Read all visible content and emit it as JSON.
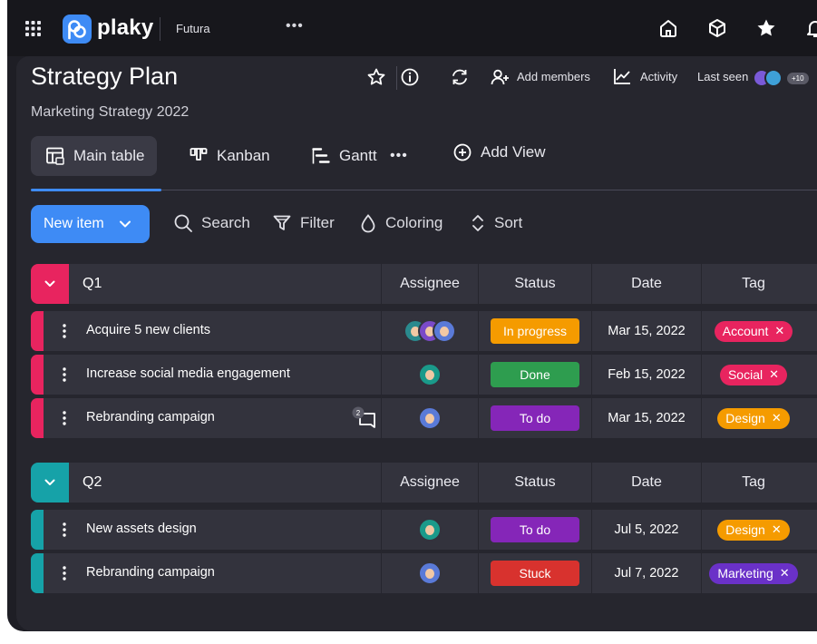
{
  "app": {
    "logo_text": "plaky",
    "workspace": "Futura",
    "more_label": "•••"
  },
  "board": {
    "title": "Strategy Plan",
    "subtitle": "Marketing Strategy 2022",
    "add_members_label": "Add members",
    "activity_label": "Activity",
    "last_seen_label": "Last seen",
    "last_seen_count": "+10"
  },
  "views": {
    "main_table": "Main table",
    "kanban": "Kanban",
    "gantt": "Gantt",
    "more": "•••",
    "add_view": "Add View"
  },
  "toolbar": {
    "new_item": "New item",
    "search": "Search",
    "filter": "Filter",
    "coloring": "Coloring",
    "sort": "Sort"
  },
  "columns": {
    "assignee": "Assignee",
    "status": "Status",
    "date": "Date",
    "tag": "Tag"
  },
  "colors": {
    "accent": "#3e8bf5",
    "q1": "#e8245f",
    "q2": "#16a2a8",
    "in_progress": "#f59b00",
    "done": "#2e9d4f",
    "to_do": "#8526b8",
    "stuck": "#d8322e",
    "tag_account": "#e8245f",
    "tag_social": "#e8245f",
    "tag_design": "#f59b00",
    "tag_marketing": "#6a31c8"
  },
  "groups": [
    {
      "name": "Q1",
      "rows": [
        {
          "name": "Acquire 5 new clients",
          "status": "In progress",
          "date": "Mar 15, 2022",
          "tag": "Account",
          "remove": "✕"
        },
        {
          "name": "Increase social media engagement",
          "status": "Done",
          "date": "Feb 15, 2022",
          "tag": "Social",
          "remove": "✕"
        },
        {
          "name": "Rebranding campaign",
          "status": "To do",
          "date": "Mar 15, 2022",
          "tag": "Design",
          "remove": "✕",
          "comments": "2"
        }
      ]
    },
    {
      "name": "Q2",
      "rows": [
        {
          "name": "New assets design",
          "status": "To do",
          "date": "Jul 5, 2022",
          "tag": "Design",
          "remove": "✕"
        },
        {
          "name": "Rebranding campaign",
          "status": "Stuck",
          "date": "Jul 7, 2022",
          "tag": "Marketing",
          "remove": "✕"
        }
      ]
    }
  ]
}
